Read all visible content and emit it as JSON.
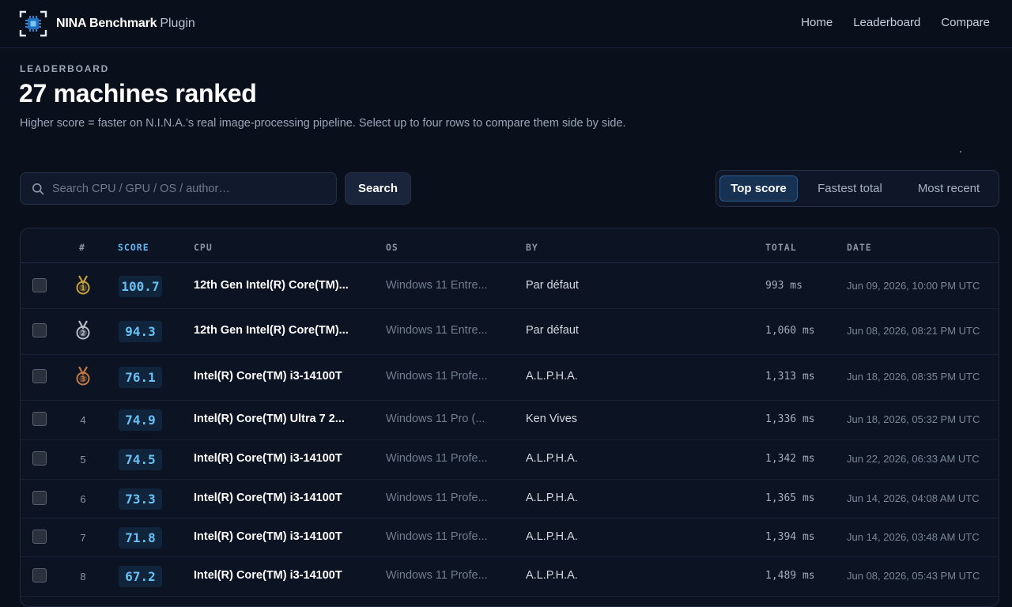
{
  "brand": {
    "name_bold": "NINA Benchmark",
    "name_light": "Plugin"
  },
  "nav": {
    "home": "Home",
    "leaderboard": "Leaderboard",
    "compare": "Compare"
  },
  "header": {
    "eyebrow": "LEADERBOARD",
    "title": "27 machines ranked",
    "subtitle": "Higher score = faster on N.I.N.A.’s real image-processing pipeline. Select up to four rows to compare them side by side."
  },
  "search": {
    "placeholder": "Search CPU / GPU / OS / author…",
    "value": "",
    "button_label": "Search"
  },
  "sort": {
    "options": [
      "Top score",
      "Fastest total",
      "Most recent"
    ],
    "active": "Top score"
  },
  "table": {
    "headers": {
      "rank": "#",
      "score": "SCORE",
      "cpu": "CPU",
      "os": "OS",
      "by": "BY",
      "total": "TOTAL",
      "date": "DATE"
    },
    "rows": [
      {
        "rank": "1",
        "medal": "gold",
        "score": "100.7",
        "cpu": "12th Gen Intel(R) Core(TM)...",
        "os": "Windows 11 Entre...",
        "by": "Par défaut",
        "total": "993 ms",
        "date": "Jun 09, 2026, 10:00 PM UTC",
        "checked": false
      },
      {
        "rank": "2",
        "medal": "silver",
        "score": "94.3",
        "cpu": "12th Gen Intel(R) Core(TM)...",
        "os": "Windows 11 Entre...",
        "by": "Par défaut",
        "total": "1,060 ms",
        "date": "Jun 08, 2026, 08:21 PM UTC",
        "checked": false
      },
      {
        "rank": "3",
        "medal": "bronze",
        "score": "76.1",
        "cpu": "Intel(R) Core(TM) i3-14100T",
        "os": "Windows 11 Profe...",
        "by": "A.L.P.H.A.",
        "total": "1,313 ms",
        "date": "Jun 18, 2026, 08:35 PM UTC",
        "checked": false
      },
      {
        "rank": "4",
        "medal": "",
        "score": "74.9",
        "cpu": "Intel(R) Core(TM) Ultra 7 2...",
        "os": "Windows 11 Pro (...",
        "by": "Ken Vives",
        "total": "1,336 ms",
        "date": "Jun 18, 2026, 05:32 PM UTC",
        "checked": false
      },
      {
        "rank": "5",
        "medal": "",
        "score": "74.5",
        "cpu": "Intel(R) Core(TM) i3-14100T",
        "os": "Windows 11 Profe...",
        "by": "A.L.P.H.A.",
        "total": "1,342 ms",
        "date": "Jun 22, 2026, 06:33 AM UTC",
        "checked": false
      },
      {
        "rank": "6",
        "medal": "",
        "score": "73.3",
        "cpu": "Intel(R) Core(TM) i3-14100T",
        "os": "Windows 11 Profe...",
        "by": "A.L.P.H.A.",
        "total": "1,365 ms",
        "date": "Jun 14, 2026, 04:08 AM UTC",
        "checked": false
      },
      {
        "rank": "7",
        "medal": "",
        "score": "71.8",
        "cpu": "Intel(R) Core(TM) i3-14100T",
        "os": "Windows 11 Profe...",
        "by": "A.L.P.H.A.",
        "total": "1,394 ms",
        "date": "Jun 14, 2026, 03:48 AM UTC",
        "checked": false
      },
      {
        "rank": "8",
        "medal": "",
        "score": "67.2",
        "cpu": "Intel(R) Core(TM) i3-14100T",
        "os": "Windows 11 Profe...",
        "by": "A.L.P.H.A.",
        "total": "1,489 ms",
        "date": "Jun 08, 2026, 05:43 PM UTC",
        "checked": false
      }
    ]
  },
  "colors": {
    "background": "#0a0f1c",
    "accent": "#68c1f5",
    "active_tab_bg": "#173153",
    "gold": "#c9a33a",
    "silver": "#b9bec8",
    "bronze": "#c27a43"
  },
  "icons": {
    "logo": "chip-icon",
    "search": "search-icon",
    "medal": "medal-icon",
    "checkbox": "checkbox-icon"
  }
}
